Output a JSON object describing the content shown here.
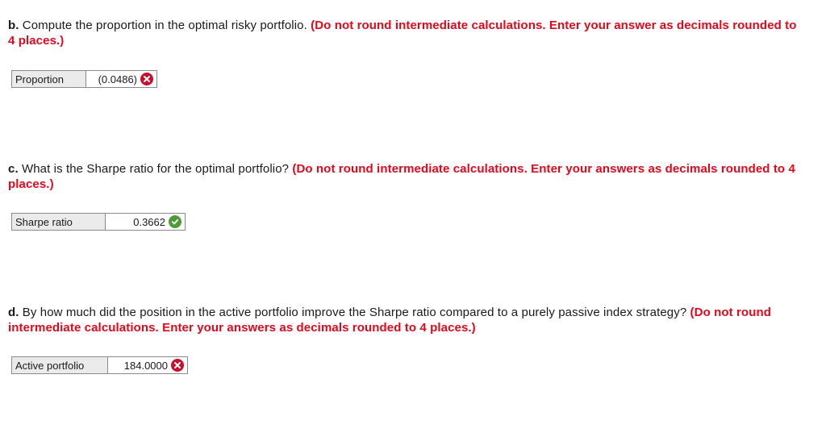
{
  "questions": [
    {
      "letter": "b.",
      "text": " Compute the proportion in the optimal risky portfolio. ",
      "instruction": "(Do not round intermediate calculations. Enter your answer as decimals rounded to 4 places.)",
      "field_label": "Proportion",
      "field_value": "(0.0486)",
      "status": "incorrect",
      "status_icon": "x-circle-icon"
    },
    {
      "letter": "c.",
      "text": " What is the Sharpe ratio for the optimal portfolio? ",
      "instruction": "(Do not round intermediate calculations. Enter your answers as decimals rounded to 4 places.)",
      "field_label": "Sharpe ratio",
      "field_value": "0.3662",
      "status": "correct",
      "status_icon": "check-circle-icon"
    },
    {
      "letter": "d.",
      "text": " By how much did the position in the active portfolio improve the Sharpe ratio compared to a purely passive index strategy? ",
      "instruction": "(Do not round intermediate calculations. Enter your answers as decimals rounded to 4 places.)",
      "field_label": "Active portfolio",
      "field_value": "184.0000",
      "status": "incorrect",
      "status_icon": "x-circle-icon"
    }
  ],
  "colors": {
    "instruction": "#e2081b",
    "incorrect": "#c8102e",
    "correct": "#4e9a3a",
    "label_bg": "#ebebeb"
  }
}
